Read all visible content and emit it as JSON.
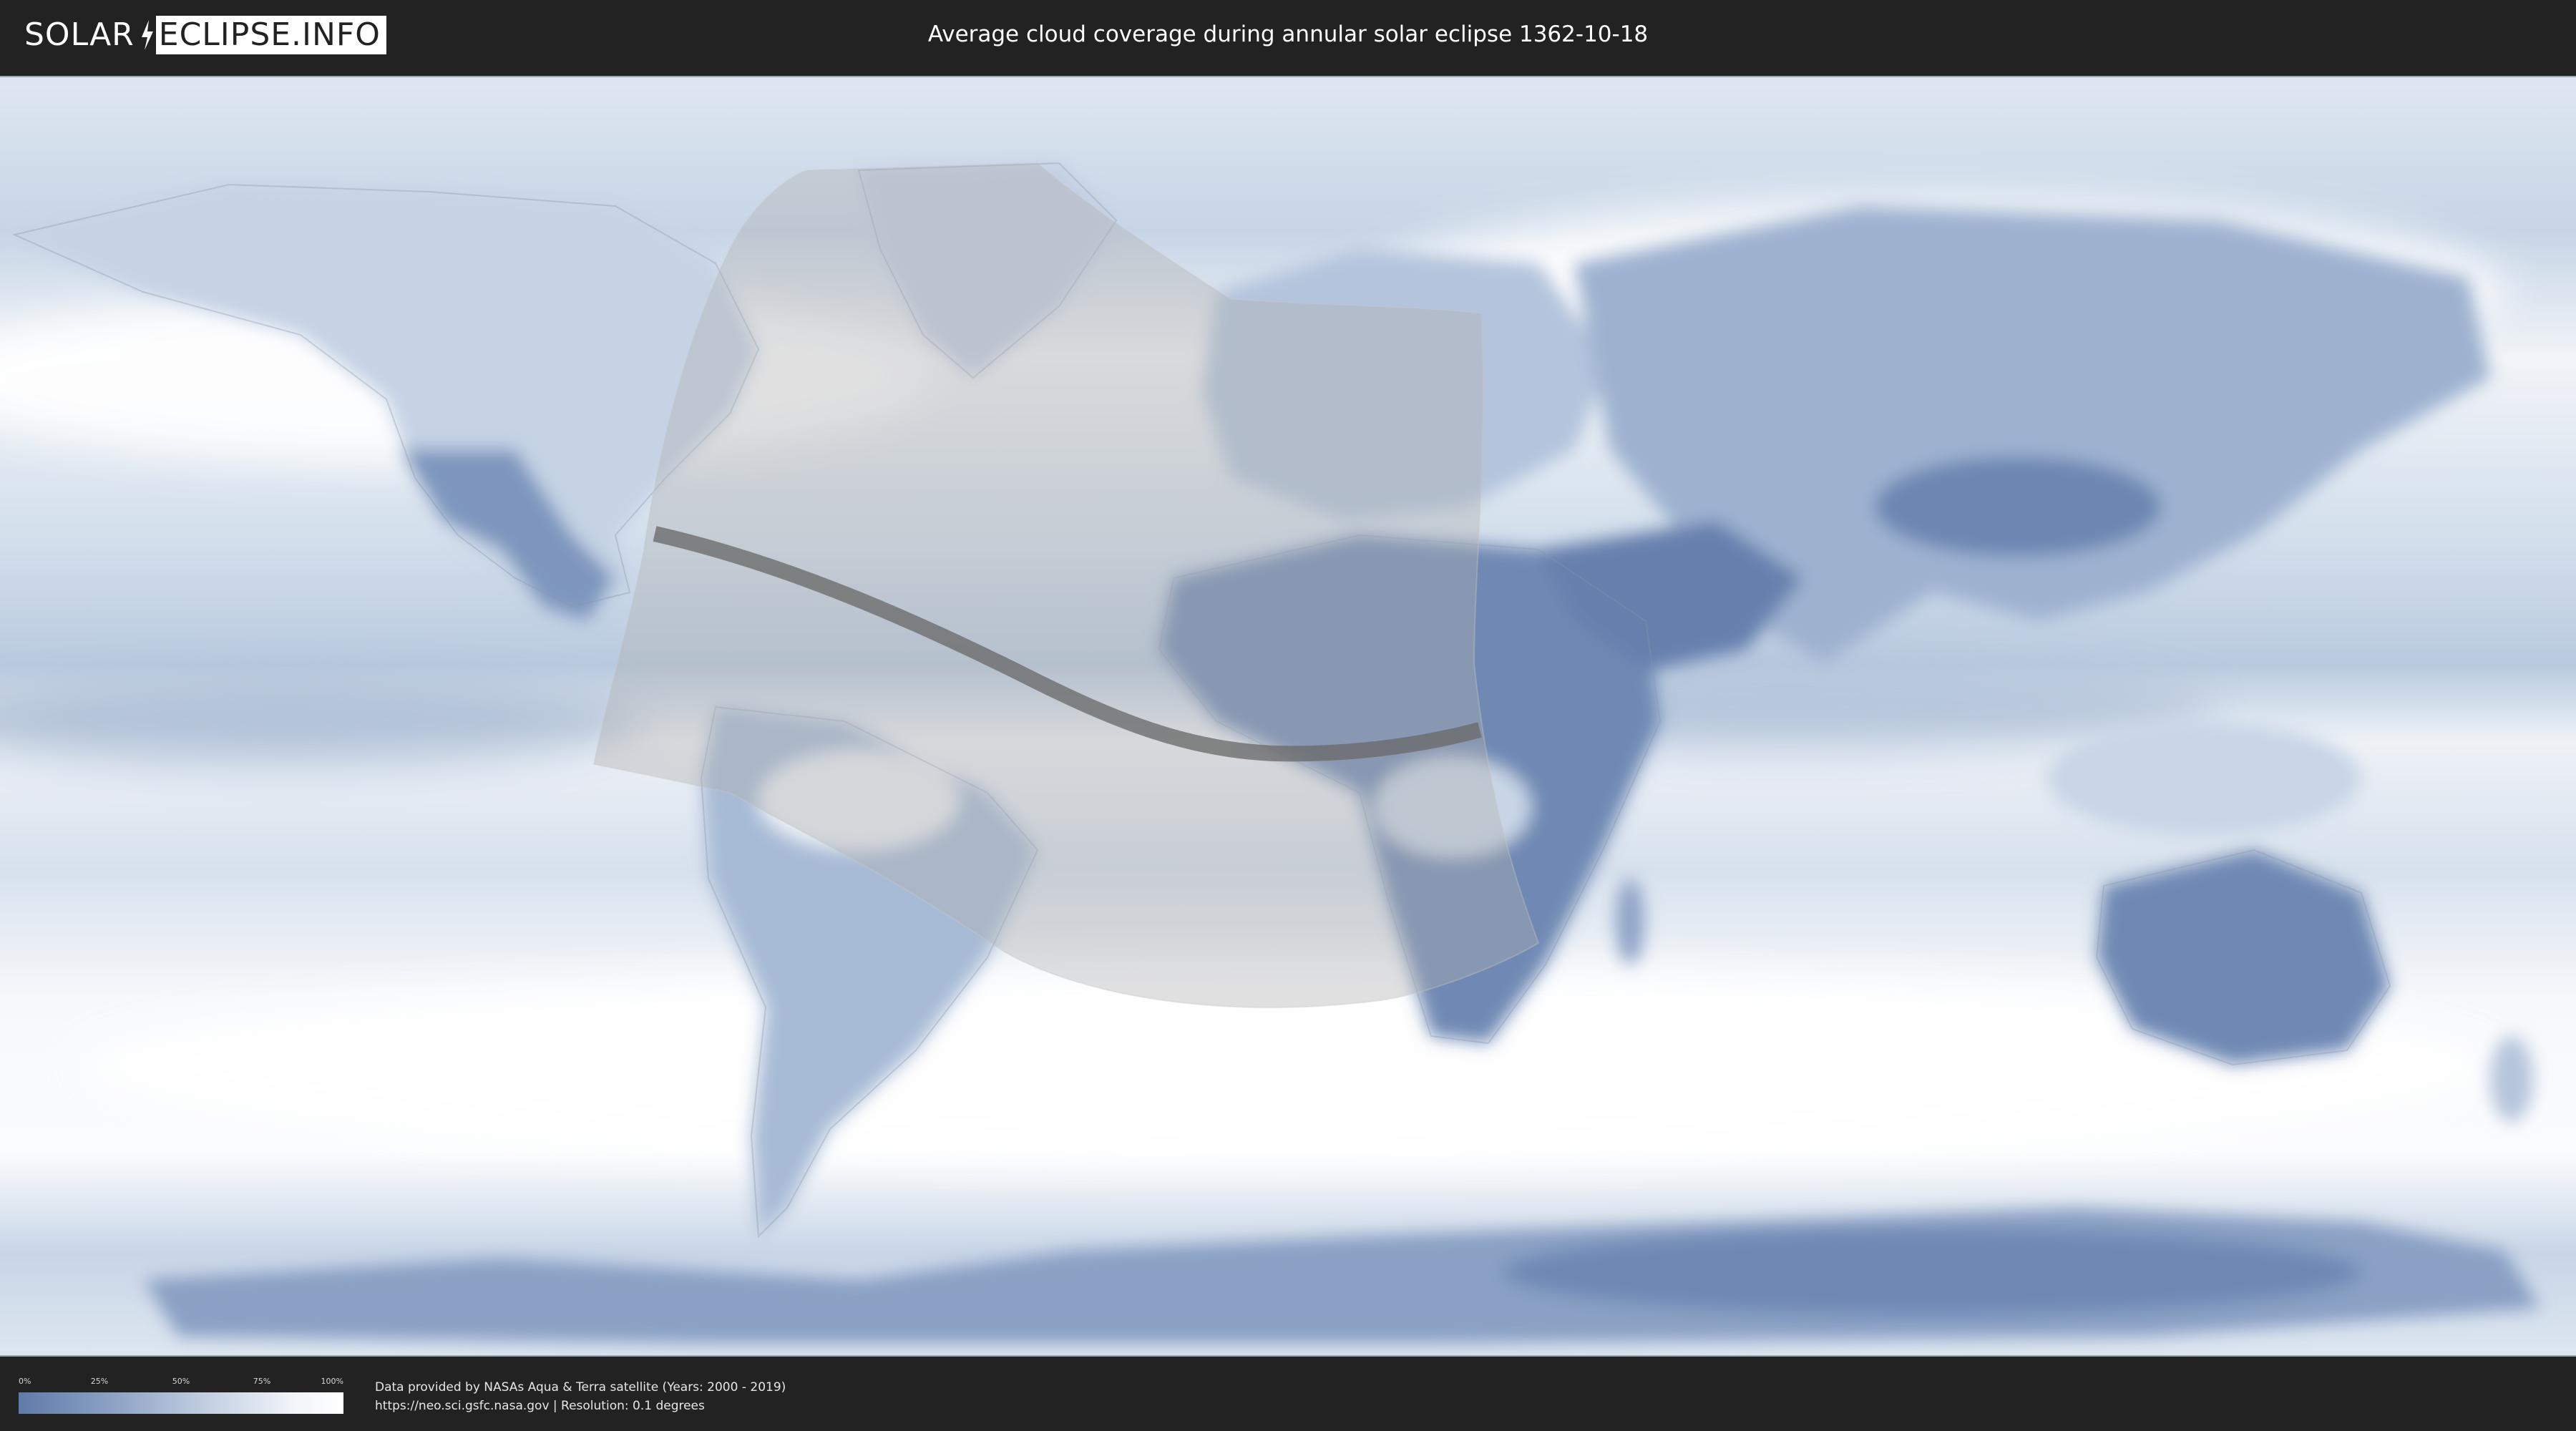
{
  "header": {
    "logo_left": "SOLAR",
    "logo_right": "ECLIPSE.INFO",
    "title": "Average cloud coverage during annular solar eclipse 1362-10-18"
  },
  "legend": {
    "ticks": [
      "0%",
      "25%",
      "50%",
      "75%",
      "100%"
    ],
    "color_low": "#5f7ba8",
    "color_high": "#ffffff"
  },
  "credits": {
    "line1": "Data provided by NASAs Aqua & Terra satellite (Years: 2000 - 2019)",
    "line2": "https://neo.sci.gsfc.nasa.gov | Resolution: 0.1 degrees"
  },
  "colors": {
    "background": "#222222",
    "ocean_cloud": "#e9eef4",
    "clear_sky": "#5f7ba8",
    "eclipse_zone": "#b8b8b8",
    "central_path": "#6a6a6a"
  }
}
